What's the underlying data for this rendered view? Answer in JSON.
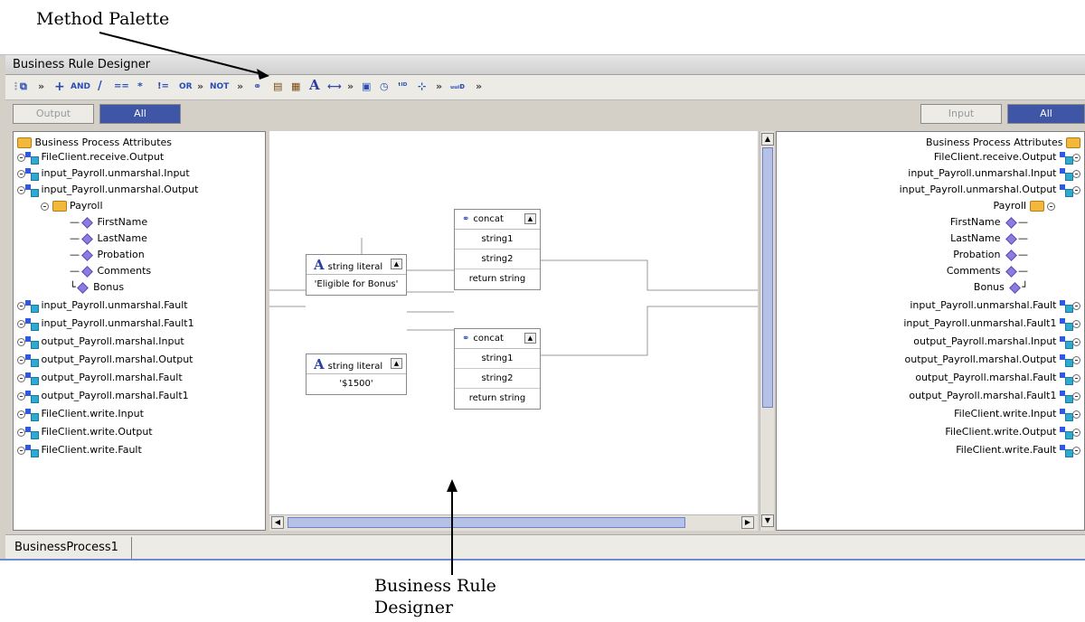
{
  "callouts": {
    "method_palette": "Method Palette",
    "business_rule_designer_line1": "Business Rule",
    "business_rule_designer_line2": "Designer"
  },
  "window": {
    "title": "Business Rule Designer"
  },
  "toolbar": {
    "items": [
      "»",
      "+",
      "AND",
      "/",
      "==",
      "*",
      "!=",
      "OR",
      "»",
      "NOT",
      "»",
      "A",
      "»",
      "»",
      "»"
    ]
  },
  "left_tabs": {
    "output": "Output",
    "all": "All"
  },
  "right_tabs": {
    "input": "Input",
    "all": "All"
  },
  "left_tree": [
    "Business Process Attributes",
    "FileClient.receive.Output",
    "input_Payroll.unmarshal.Input",
    "input_Payroll.unmarshal.Output",
    "Payroll",
    "FirstName",
    "LastName",
    "Probation",
    "Comments",
    "Bonus",
    "input_Payroll.unmarshal.Fault",
    "input_Payroll.unmarshal.Fault1",
    "output_Payroll.marshal.Input",
    "output_Payroll.marshal.Output",
    "output_Payroll.marshal.Fault",
    "output_Payroll.marshal.Fault1",
    "FileClient.write.Input",
    "FileClient.write.Output",
    "FileClient.write.Fault"
  ],
  "right_tree": [
    "Business Process Attributes",
    "FileClient.receive.Output",
    "input_Payroll.unmarshal.Input",
    "input_Payroll.unmarshal.Output",
    "Payroll",
    "FirstName",
    "LastName",
    "Probation",
    "Comments",
    "Bonus",
    "input_Payroll.unmarshal.Fault",
    "input_Payroll.unmarshal.Fault1",
    "output_Payroll.marshal.Input",
    "output_Payroll.marshal.Output",
    "output_Payroll.marshal.Fault",
    "output_Payroll.marshal.Fault1",
    "FileClient.write.Input",
    "FileClient.write.Output",
    "FileClient.write.Fault"
  ],
  "methods": {
    "literal1": {
      "title": "string literal",
      "value": "'Eligible for Bonus'"
    },
    "literal2": {
      "title": "string literal",
      "value": "'$1500'"
    },
    "concat1": {
      "title": "concat",
      "in1": "string1",
      "in2": "string2",
      "out": "return string"
    },
    "concat2": {
      "title": "concat",
      "in1": "string1",
      "in2": "string2",
      "out": "return string"
    }
  },
  "bottom_tab": {
    "label": "BusinessProcess1"
  },
  "colors": {
    "accent": "#3f55a6",
    "scroll_thumb": "#b5c1e6"
  }
}
